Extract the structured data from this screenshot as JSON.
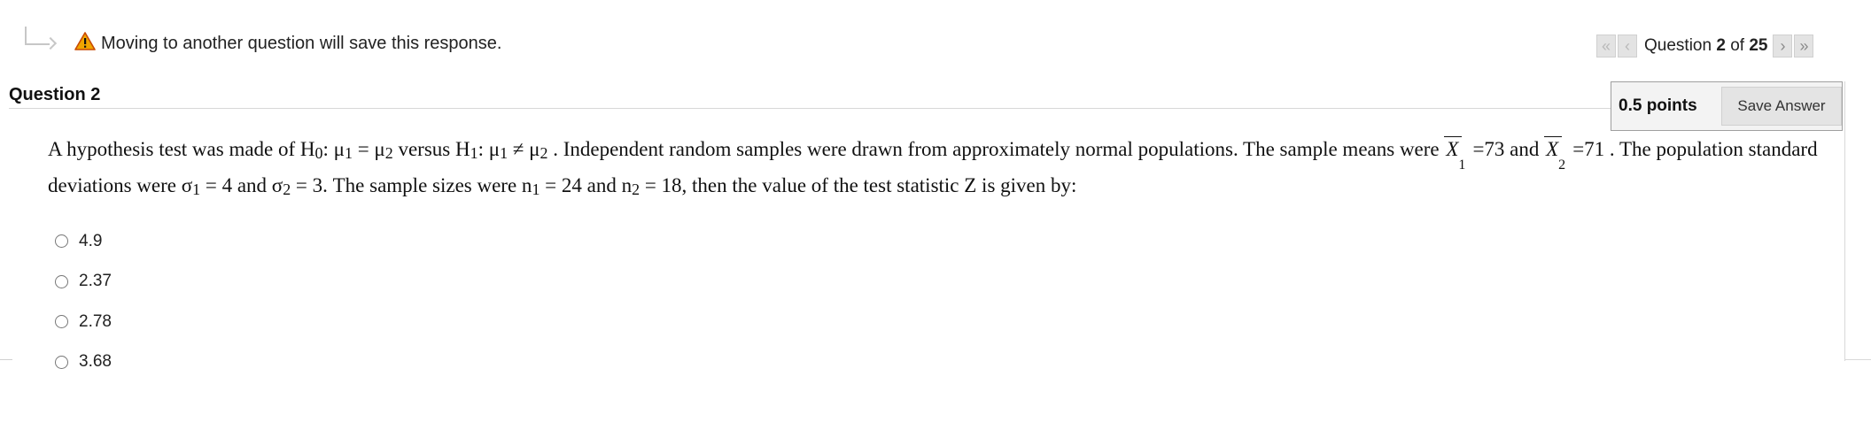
{
  "notice": {
    "text": "Moving to another question will save this response."
  },
  "pager": {
    "prefix": "Question",
    "current": "2",
    "of_label": "of",
    "total": "25",
    "first_glyph": "«",
    "prev_glyph": "‹",
    "next_glyph": "›",
    "last_glyph": "»"
  },
  "question": {
    "title": "Question 2",
    "points": "0.5 points",
    "save_label": "Save Answer",
    "text": {
      "p1": "A hypothesis test was made of H",
      "h0_sub": "0",
      "p2": ": μ",
      "mu1_sub": "1",
      "p3": " = μ",
      "mu2_sub": "2",
      "p4": " versus H",
      "h1_sub": "1",
      "p5": ": μ",
      "mu1b_sub": "1",
      "p6": " ≠ μ",
      "mu2b_sub": "2",
      "p7": " . Independent random samples were drawn from approximately normal populations. The sample means were ",
      "xbar1": "X",
      "xbar1_sub": "1",
      "p8": "=73 and ",
      "xbar2": "X",
      "xbar2_sub": "2",
      "p9": "=71 . The population standard deviations were σ",
      "s1_sub": "1",
      "p10": " = 4 and ",
      "p10b": "σ",
      "s2_sub": "2",
      "p11": " = 3. The sample sizes were n",
      "n1_sub": "1",
      "p12": " = 24 and n",
      "n2_sub": "2",
      "p13": " = 18, then the value of the test statistic Z is given by:"
    }
  },
  "options": [
    {
      "label": "4.9"
    },
    {
      "label": "2.37"
    },
    {
      "label": "2.78"
    },
    {
      "label": "3.68"
    }
  ],
  "colors": {
    "warning": "#f0a500",
    "nav_bg": "#e3e3e3"
  }
}
